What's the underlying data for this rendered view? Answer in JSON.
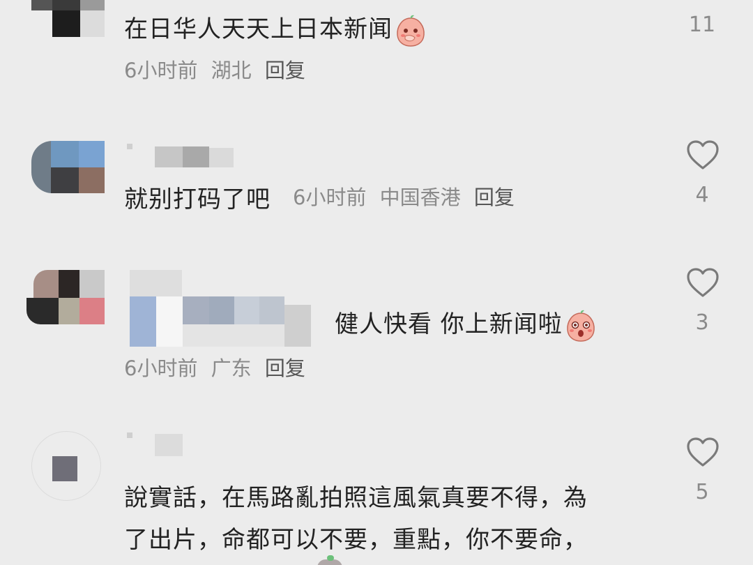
{
  "comments": [
    {
      "text": "在日华人天天上日本新闻",
      "time": "6小时前",
      "location": "湖北",
      "reply_label": "回复",
      "likes": "11",
      "emoji": "peach-cover-mouth-emoji"
    },
    {
      "text": "就别打码了吧",
      "time": "6小时前",
      "location": "中国香港",
      "reply_label": "回复",
      "likes": "4"
    },
    {
      "text": "健人快看 你上新闻啦",
      "time": "6小时前",
      "location": "广东",
      "reply_label": "回复",
      "likes": "3",
      "emoji": "peach-surprised-emoji"
    },
    {
      "text_line1": "說實話，在馬路亂拍照這風氣真要不得，為",
      "text_line2": "了出片，命都可以不要，重點，你不要命，",
      "likes": "5"
    }
  ],
  "icons": {
    "like": "heart-outline-icon"
  },
  "colors": {
    "background": "#ececec",
    "text": "#222222",
    "meta": "#8a8a8a",
    "emoji_peach": "#f4a89a"
  }
}
